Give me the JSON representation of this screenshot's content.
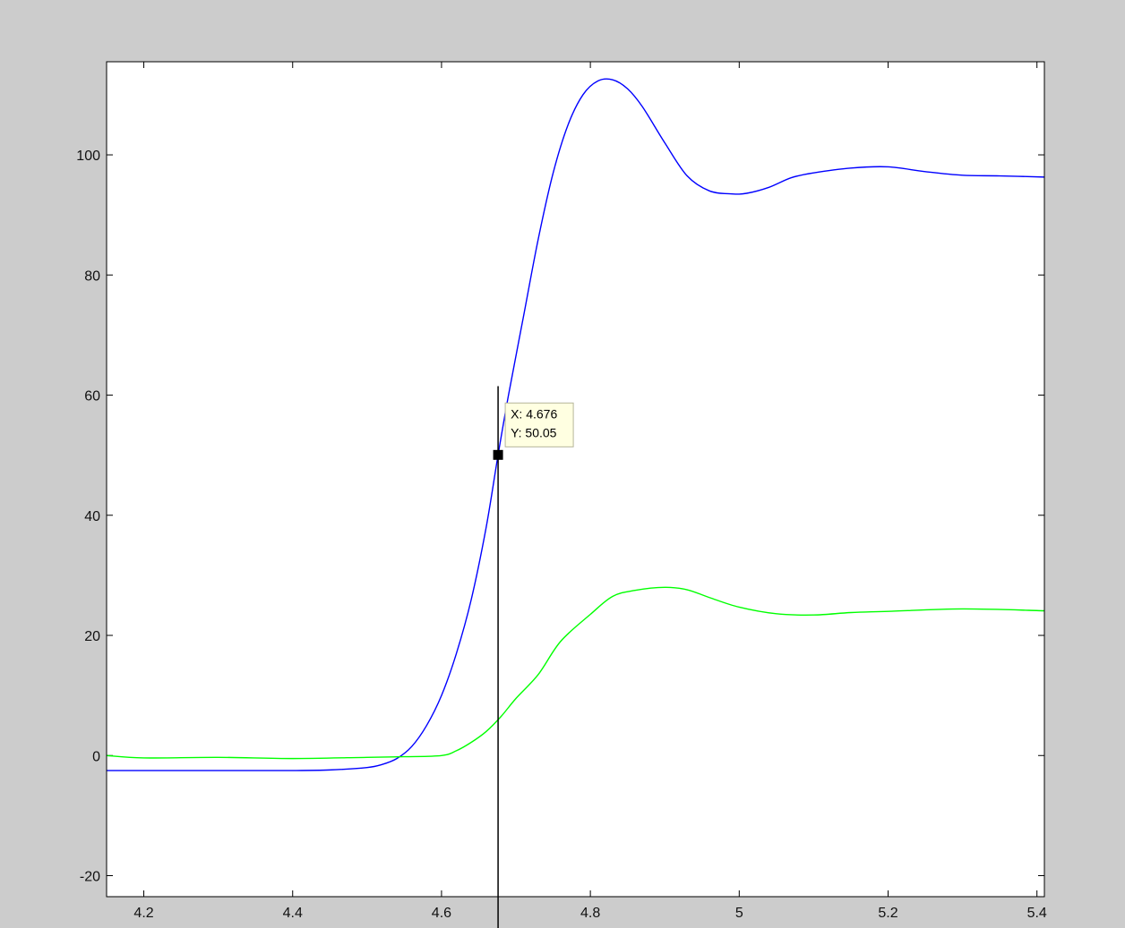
{
  "chart_data": {
    "type": "line",
    "title": "",
    "xlabel": "",
    "ylabel": "",
    "xlim": [
      4.15,
      5.41
    ],
    "ylim": [
      -23.5,
      115.5
    ],
    "x_ticks": [
      4.2,
      4.4,
      4.6,
      4.8,
      5,
      5.2,
      5.4
    ],
    "x_tick_labels": [
      "4.2",
      "4.4",
      "4.6",
      "4.8",
      "5",
      "5.2",
      "5.4"
    ],
    "y_ticks": [
      -20,
      0,
      20,
      40,
      60,
      80,
      100
    ],
    "y_tick_labels": [
      "-20",
      "0",
      "20",
      "40",
      "60",
      "80",
      "100"
    ],
    "grid": false,
    "background": "#ffffff",
    "figure_color": "#cccccc",
    "series": [
      {
        "color": "#0000ff",
        "x": [
          4.15,
          4.2,
          4.3,
          4.4,
          4.45,
          4.5,
          4.52,
          4.54,
          4.56,
          4.58,
          4.6,
          4.62,
          4.64,
          4.66,
          4.676,
          4.69,
          4.71,
          4.73,
          4.75,
          4.77,
          4.79,
          4.81,
          4.83,
          4.85,
          4.87,
          4.9,
          4.93,
          4.96,
          4.99,
          5.01,
          5.04,
          5.07,
          5.1,
          5.15,
          5.2,
          5.25,
          5.3,
          5.35,
          5.41
        ],
        "y": [
          -2.5,
          -2.5,
          -2.5,
          -2.5,
          -2.4,
          -2.0,
          -1.5,
          -0.5,
          1.5,
          5.0,
          10.0,
          17.0,
          26.0,
          38.0,
          50.05,
          60.0,
          73.0,
          86.0,
          97.0,
          105.0,
          110.0,
          112.3,
          112.5,
          111.0,
          108.0,
          102.0,
          96.5,
          94.0,
          93.5,
          93.6,
          94.6,
          96.2,
          97.0,
          97.8,
          98.0,
          97.2,
          96.6,
          96.5,
          96.3
        ]
      },
      {
        "color": "#00ff00",
        "x": [
          4.15,
          4.2,
          4.3,
          4.4,
          4.5,
          4.55,
          4.6,
          4.62,
          4.64,
          4.66,
          4.68,
          4.7,
          4.73,
          4.76,
          4.8,
          4.83,
          4.86,
          4.9,
          4.93,
          4.96,
          5.0,
          5.05,
          5.1,
          5.15,
          5.2,
          5.3,
          5.41
        ],
        "y": [
          0.0,
          -0.4,
          -0.3,
          -0.5,
          -0.3,
          -0.2,
          0.0,
          0.8,
          2.2,
          4.0,
          6.5,
          9.5,
          13.5,
          19.0,
          23.5,
          26.5,
          27.5,
          28.0,
          27.6,
          26.3,
          24.7,
          23.6,
          23.4,
          23.8,
          24.0,
          24.4,
          24.1
        ]
      }
    ],
    "datatip": {
      "x": 4.676,
      "y": 50.05,
      "x_text": "X: 4.676",
      "y_text": "Y: 50.05",
      "cursor_top_y": 61.5
    }
  }
}
